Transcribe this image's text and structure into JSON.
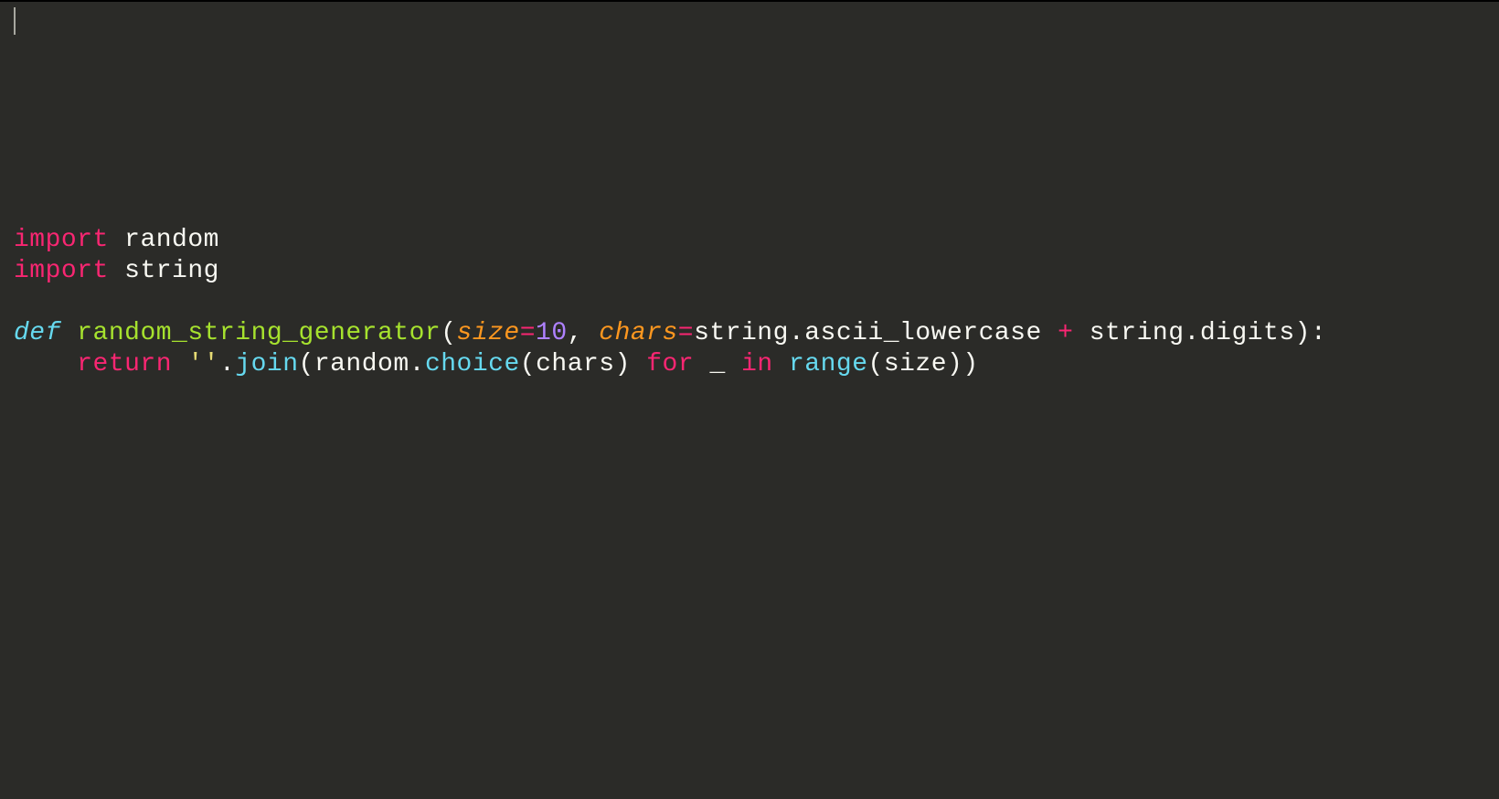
{
  "code": {
    "line1": {
      "kw_import1": "import",
      "sp1": " ",
      "mod_random": "random"
    },
    "line2": {
      "kw_import2": "import",
      "sp2": " ",
      "mod_string": "string"
    },
    "line4": {
      "kw_def": "def",
      "sp3": " ",
      "fn_name": "random_string_generator",
      "lparen": "(",
      "param_size": "size",
      "eq1": "=",
      "num_10": "10",
      "comma1": ", ",
      "param_chars": "chars",
      "eq2": "=",
      "str_mod": "string",
      "dot1": ".",
      "ascii_lowercase": "ascii_lowercase ",
      "plus": "+",
      "sp4": " ",
      "str_mod2": "string",
      "dot2": ".",
      "digits": "digits",
      "rparen_colon": "):"
    },
    "line5": {
      "indent": "    ",
      "kw_return": "return",
      "sp5": " ",
      "empty_str": "''",
      "dot3": ".",
      "join": "join",
      "lparen2": "(",
      "random_mod": "random",
      "dot4": ".",
      "choice": "choice",
      "lparen3": "(",
      "chars_arg": "chars",
      "rparen3": ") ",
      "kw_for": "for",
      "sp6": " _ ",
      "kw_in": "in",
      "sp7": " ",
      "range": "range",
      "lparen4": "(",
      "size_arg": "size",
      "rparen4": "))"
    }
  }
}
